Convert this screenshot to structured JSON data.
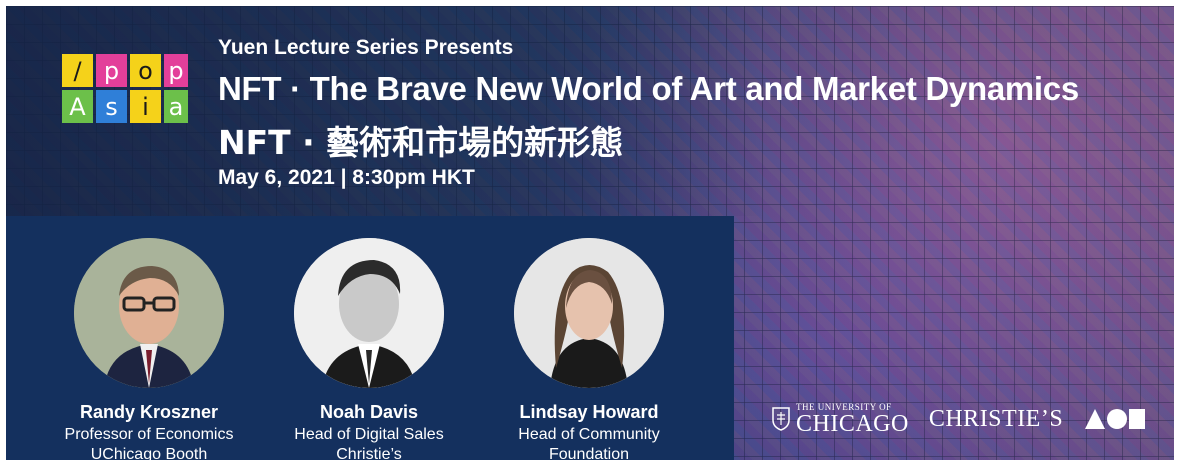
{
  "header": {
    "series": "Yuen Lecture Series Presents",
    "title_en": "NFT · The Brave New World of Art and Market Dynamics",
    "title_zh": "NFT · 藝術和市場的新形態",
    "date": "May 6, 2021 | 8:30pm HKT"
  },
  "logo": {
    "cells": [
      {
        "ch": "/",
        "bg": "#f5d21a",
        "fg": "#1a1a1a"
      },
      {
        "ch": "p",
        "bg": "#e33f9a",
        "fg": "#ffffff"
      },
      {
        "ch": "o",
        "bg": "#f5d21a",
        "fg": "#1a1a1a"
      },
      {
        "ch": "p",
        "bg": "#e33f9a",
        "fg": "#ffffff"
      },
      {
        "ch": "/",
        "bg": "#f5d21a",
        "fg": "#1a1a1a"
      },
      {
        "ch": "A",
        "bg": "#6cc04a",
        "fg": "#ffffff"
      },
      {
        "ch": "s",
        "bg": "#2f7fd8",
        "fg": "#ffffff"
      },
      {
        "ch": "i",
        "bg": "#f5d21a",
        "fg": "#1a1a1a"
      },
      {
        "ch": "a",
        "bg": "#6cc04a",
        "fg": "#ffffff"
      }
    ]
  },
  "speakers": [
    {
      "name": "Randy Kroszner",
      "title": "Professor of Economics",
      "org": "UChicago Booth"
    },
    {
      "name": "Noah Davis",
      "title": "Head of Digital Sales",
      "org": "Christie’s"
    },
    {
      "name": "Lindsay Howard",
      "title": "Head of Community",
      "org": "Foundation"
    }
  ],
  "partners": {
    "uchicago_small": "THE UNIVERSITY OF",
    "uchicago_big": "CHICAGO",
    "christies": "CHRISTIE’S",
    "aoi_icon": "aoi-logo-icon"
  },
  "colors": {
    "panel": "#14305e",
    "text": "#ffffff"
  }
}
